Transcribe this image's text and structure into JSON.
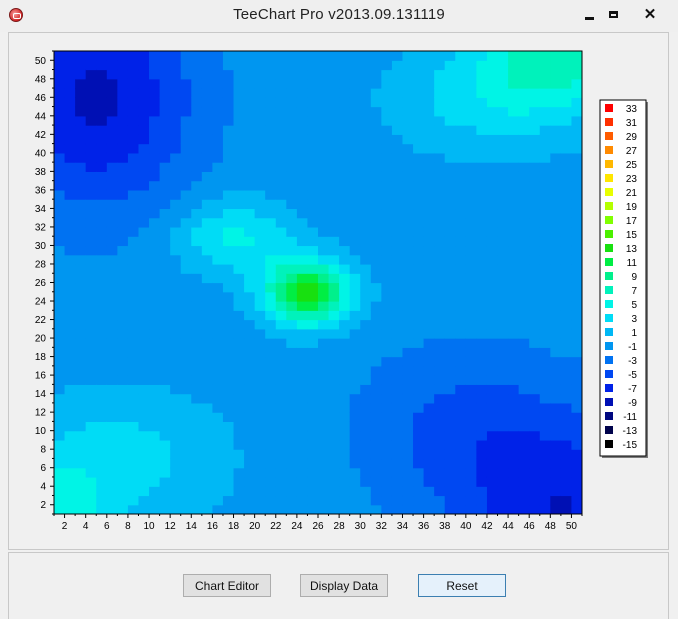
{
  "window": {
    "title": "TeeChart Pro v2013.09.131119",
    "controls": {
      "minimize": "minimize",
      "maximize": "maximize",
      "close": "close"
    }
  },
  "buttons": {
    "chart_editor": "Chart Editor",
    "display_data": "Display Data",
    "reset": "Reset"
  },
  "chart_data": {
    "type": "heatmap",
    "title": "",
    "xlabel": "",
    "ylabel": "",
    "x_range": [
      1,
      51
    ],
    "y_range": [
      1,
      51
    ],
    "x_ticks": [
      2,
      4,
      6,
      8,
      10,
      12,
      14,
      16,
      18,
      20,
      22,
      24,
      26,
      28,
      30,
      32,
      34,
      36,
      38,
      40,
      42,
      44,
      46,
      48,
      50
    ],
    "y_ticks": [
      2,
      4,
      6,
      8,
      10,
      12,
      14,
      16,
      18,
      20,
      22,
      24,
      26,
      28,
      30,
      32,
      34,
      36,
      38,
      40,
      42,
      44,
      46,
      48,
      50
    ],
    "value_range": [
      -15,
      33
    ],
    "peak": {
      "x": 25,
      "y": 25,
      "value": 13
    },
    "legend_position": "right",
    "legend": [
      {
        "label": "33",
        "color": "#ff0000"
      },
      {
        "label": "31",
        "color": "#ff3000"
      },
      {
        "label": "29",
        "color": "#ff5c00"
      },
      {
        "label": "27",
        "color": "#ff8a00"
      },
      {
        "label": "25",
        "color": "#ffb800"
      },
      {
        "label": "23",
        "color": "#ffe600"
      },
      {
        "label": "21",
        "color": "#e8ff00"
      },
      {
        "label": "19",
        "color": "#b4ff00"
      },
      {
        "label": "17",
        "color": "#80ff00"
      },
      {
        "label": "15",
        "color": "#4cf000"
      },
      {
        "label": "13",
        "color": "#18e010"
      },
      {
        "label": "11",
        "color": "#00ee44"
      },
      {
        "label": "9",
        "color": "#00f08c"
      },
      {
        "label": "7",
        "color": "#00f2bb"
      },
      {
        "label": "5",
        "color": "#00f4e6"
      },
      {
        "label": "3",
        "color": "#00dcf6"
      },
      {
        "label": "1",
        "color": "#00b8f5"
      },
      {
        "label": "-1",
        "color": "#0096f0"
      },
      {
        "label": "-3",
        "color": "#0072f2"
      },
      {
        "label": "-5",
        "color": "#0048f2"
      },
      {
        "label": "-7",
        "color": "#0022e8"
      },
      {
        "label": "-9",
        "color": "#0010b4"
      },
      {
        "label": "-11",
        "color": "#000880"
      },
      {
        "label": "-13",
        "color": "#00034c"
      },
      {
        "label": "-15",
        "color": "#000000"
      }
    ]
  }
}
